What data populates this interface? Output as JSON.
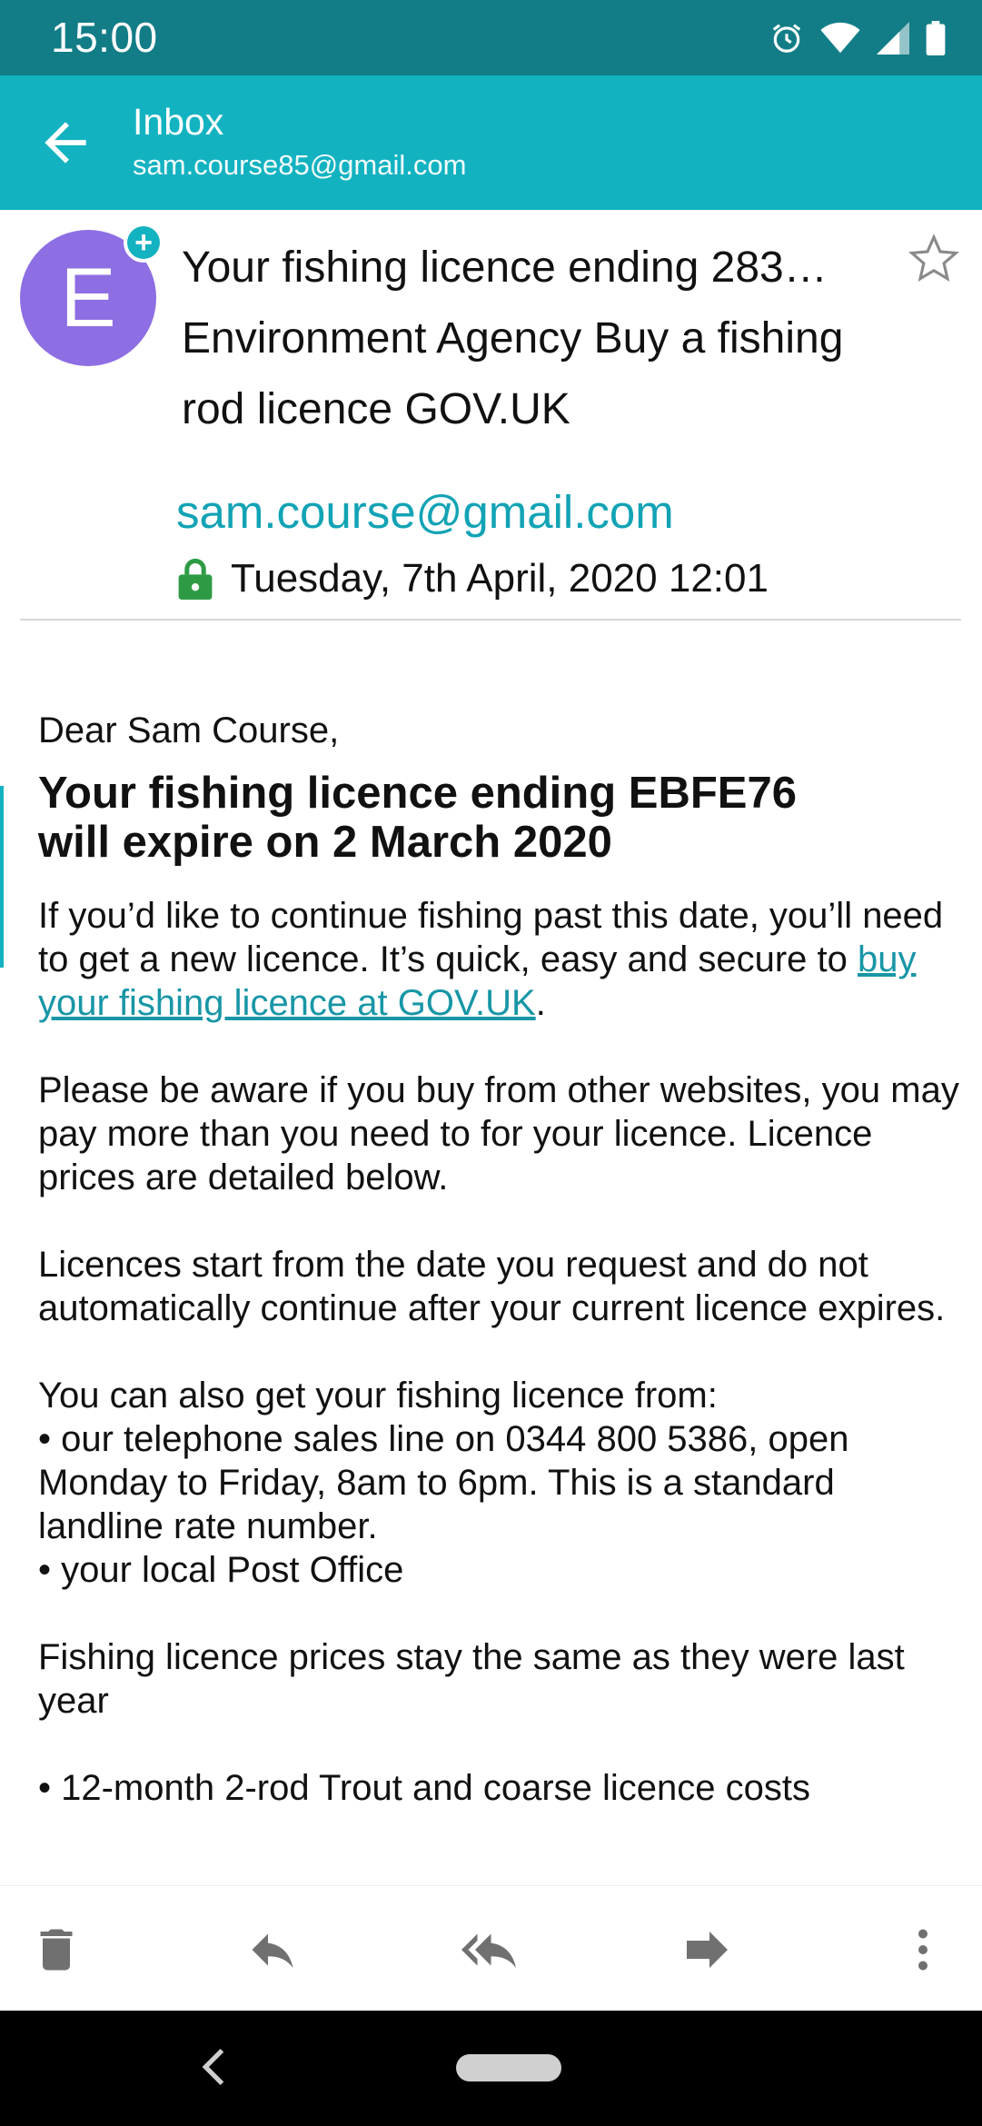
{
  "status_bar": {
    "time": "15:00",
    "icons": [
      "alarm-icon",
      "wifi-icon",
      "signal-icon",
      "battery-icon"
    ]
  },
  "app_bar": {
    "title": "Inbox",
    "account": "sam.course85@gmail.com"
  },
  "message": {
    "avatar_letter": "E",
    "subject_line1": "Your fishing licence ending 283…",
    "subject_line2": "Environment Agency Buy a fishing",
    "subject_line3": "rod licence GOV.UK",
    "sender": "sam.course@gmail.com",
    "date": "Tuesday, 7th April, 2020 12:01"
  },
  "body": {
    "greeting": "Dear Sam Course,",
    "heading_line1": "Your fishing licence ending EBFE76",
    "heading_line2": "will expire on 2 March 2020",
    "p1_before": "If you’d like to continue fishing past this date, you’ll need to get a new licence. It’s quick, easy and secure to ",
    "p1_link": "buy your fishing licence at GOV.UK",
    "p1_after": ".",
    "p2": "Please be aware if you buy from other websites, you may pay more than you need to for your licence. Licence prices are detailed below.",
    "p3": "Licences start from the date you request and do not automatically continue after your current licence expires.",
    "p4_intro": "You can also get your fishing licence from:",
    "p4_bullet1": "• our telephone sales line on 0344 800 5386, open Monday to Friday, 8am to 6pm. This is a standard landline rate number.",
    "p4_bullet2": "• your local Post Office",
    "p5": "Fishing licence prices stay the same as they were last year",
    "p6_bullet": "• 12-month 2-rod Trout and coarse licence costs"
  },
  "actions": [
    "delete-icon",
    "reply-icon",
    "reply-all-icon",
    "forward-icon",
    "more-icon"
  ],
  "colors": {
    "status_bar": "#127d87",
    "app_bar": "#12b2c1",
    "accent": "#12a3b5",
    "avatar": "#8d6ee3",
    "lock": "#2e9b44"
  }
}
